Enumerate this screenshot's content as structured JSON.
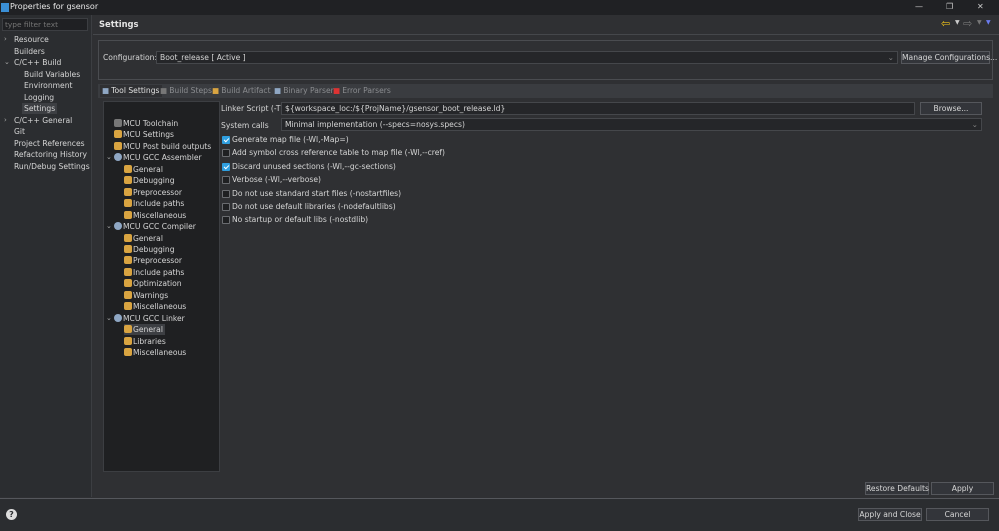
{
  "window": {
    "title": "Properties for gsensor",
    "min": "—",
    "restore": "❐",
    "close": "✕"
  },
  "nav": {
    "filter_placeholder": "type filter text",
    "items": [
      {
        "label": "Resource",
        "level": 0,
        "expander": "›"
      },
      {
        "label": "Builders",
        "level": 0
      },
      {
        "label": "C/C++ Build",
        "level": 0,
        "expander": "⌄"
      },
      {
        "label": "Build Variables",
        "level": 1
      },
      {
        "label": "Environment",
        "level": 1
      },
      {
        "label": "Logging",
        "level": 1
      },
      {
        "label": "Settings",
        "level": 1,
        "selected": true
      },
      {
        "label": "C/C++ General",
        "level": 0,
        "expander": "›"
      },
      {
        "label": "Git",
        "level": 0
      },
      {
        "label": "Project References",
        "level": 0
      },
      {
        "label": "Refactoring History",
        "level": 0
      },
      {
        "label": "Run/Debug Settings",
        "level": 0
      }
    ]
  },
  "header": {
    "title": "Settings",
    "back_icon": "arrow-left",
    "forward_icon": "arrow-right",
    "menu_icon": "chevron-down"
  },
  "config": {
    "label": "Configuration:",
    "value": "Boot_release  [ Active ]",
    "manage": "Manage Configurations..."
  },
  "tabs": [
    {
      "label": "Tool Settings",
      "active": true
    },
    {
      "label": "Build Steps"
    },
    {
      "label": "Build Artifact"
    },
    {
      "label": "Binary Parsers"
    },
    {
      "label": "Error Parsers"
    }
  ],
  "tree": [
    {
      "label": "MCU Toolchain",
      "level": 0,
      "icon": "tool"
    },
    {
      "label": "MCU Settings",
      "level": 0,
      "icon": "settings"
    },
    {
      "label": "MCU Post build outputs",
      "level": 0,
      "icon": "settings"
    },
    {
      "label": "MCU GCC Assembler",
      "level": 0,
      "icon": "gear",
      "expander": "⌄"
    },
    {
      "label": "General",
      "level": 1
    },
    {
      "label": "Debugging",
      "level": 1
    },
    {
      "label": "Preprocessor",
      "level": 1
    },
    {
      "label": "Include paths",
      "level": 1
    },
    {
      "label": "Miscellaneous",
      "level": 1
    },
    {
      "label": "MCU GCC Compiler",
      "level": 0,
      "icon": "gear",
      "expander": "⌄"
    },
    {
      "label": "General",
      "level": 1
    },
    {
      "label": "Debugging",
      "level": 1
    },
    {
      "label": "Preprocessor",
      "level": 1
    },
    {
      "label": "Include paths",
      "level": 1
    },
    {
      "label": "Optimization",
      "level": 1
    },
    {
      "label": "Warnings",
      "level": 1
    },
    {
      "label": "Miscellaneous",
      "level": 1
    },
    {
      "label": "MCU GCC Linker",
      "level": 0,
      "icon": "gear",
      "expander": "⌄"
    },
    {
      "label": "General",
      "level": 1,
      "selected": true
    },
    {
      "label": "Libraries",
      "level": 1
    },
    {
      "label": "Miscellaneous",
      "level": 1
    }
  ],
  "linker": {
    "script_label": "Linker Script (-T)",
    "script_value": "${workspace_loc:/${ProjName}/gsensor_boot_release.ld}",
    "browse": "Browse...",
    "syscalls_label": "System calls",
    "syscalls_value": "Minimal implementation (--specs=nosys.specs)",
    "options": [
      {
        "label": "Generate map file (-Wl,-Map=)",
        "checked": true
      },
      {
        "label": "Add symbol cross reference table to map file (-Wl,--cref)",
        "checked": false
      },
      {
        "label": "Discard unused sections (-Wl,--gc-sections)",
        "checked": true
      },
      {
        "label": "Verbose (-Wl,--verbose)",
        "checked": false
      },
      {
        "label": "Do not use standard start files (-nostartfiles)",
        "checked": false
      },
      {
        "label": "Do not use default libraries (-nodefaultlibs)",
        "checked": false
      },
      {
        "label": "No startup or default libs (-nostdlib)",
        "checked": false
      }
    ]
  },
  "buttons": {
    "restore": "Restore Defaults",
    "apply": "Apply",
    "apply_close": "Apply and Close",
    "cancel": "Cancel",
    "help": "?"
  },
  "colors": {
    "accent": "#2f9fe0",
    "back_arrow": "#f0c419"
  }
}
